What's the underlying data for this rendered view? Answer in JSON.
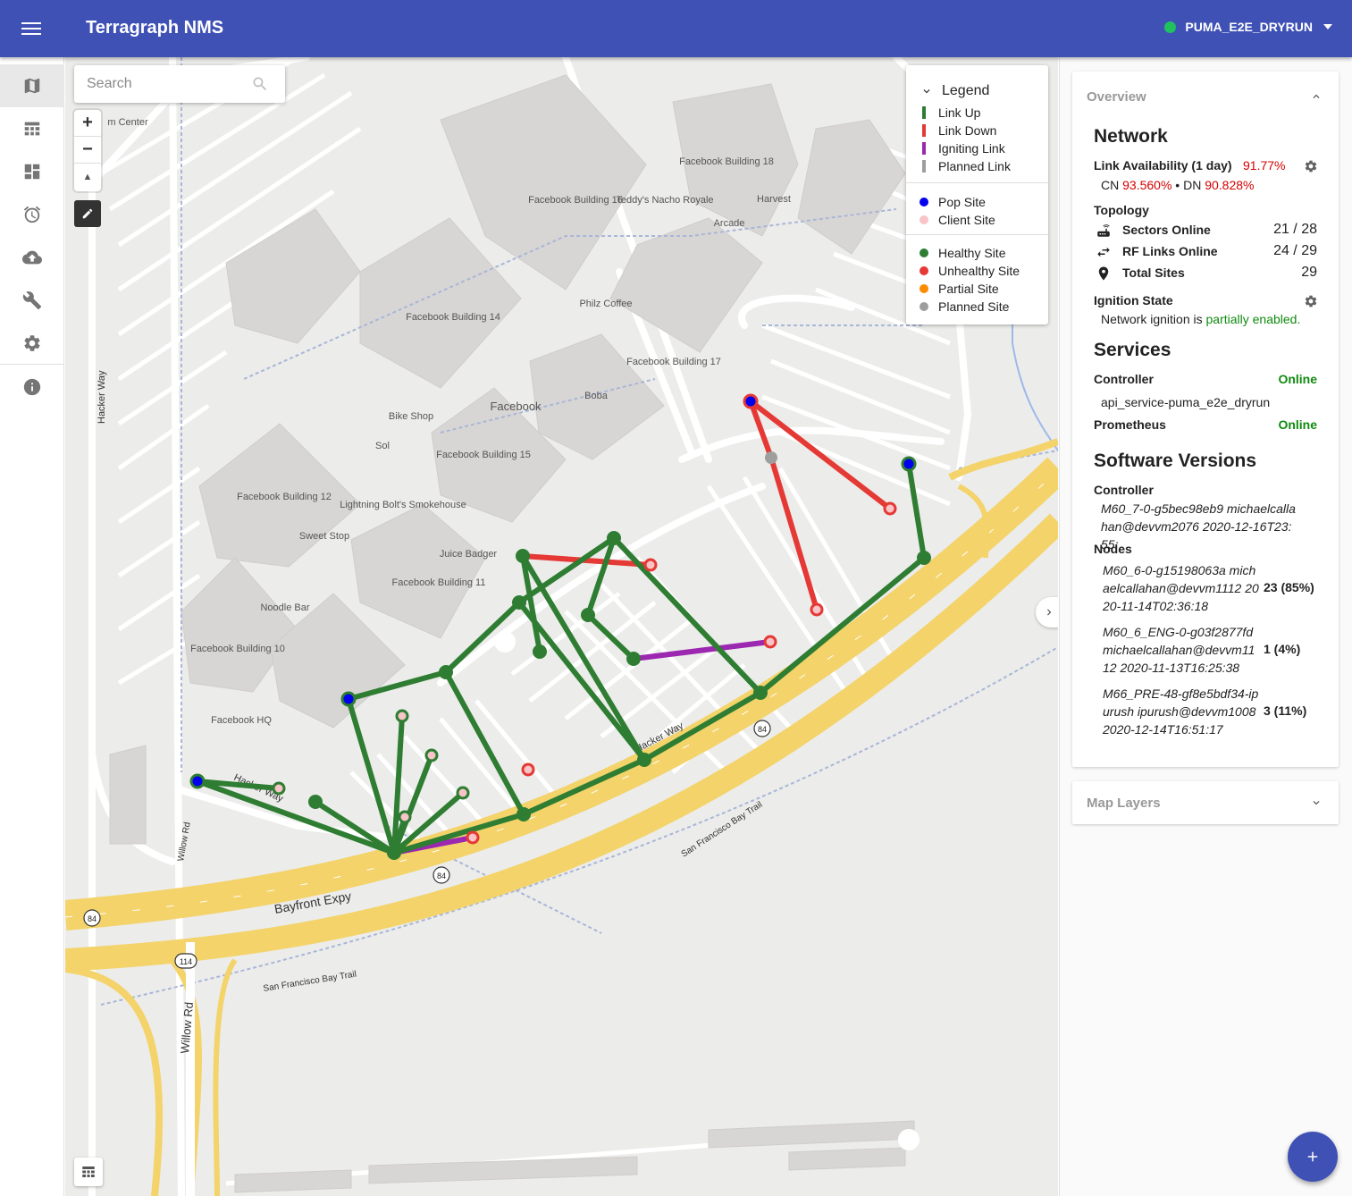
{
  "app": {
    "title": "Terragraph NMS",
    "network_name": "PUMA_E2E_DRYRUN",
    "network_status_color": "#21c25e",
    "brand_color": "#3f51b5"
  },
  "nav": {
    "items": [
      {
        "name": "map-icon",
        "active": true
      },
      {
        "name": "table-icon",
        "active": false
      },
      {
        "name": "dashboard-icon",
        "active": false
      },
      {
        "name": "alarm-icon",
        "active": false
      },
      {
        "name": "cloud-upload-icon",
        "active": false
      },
      {
        "name": "wrench-icon",
        "active": false
      },
      {
        "name": "gear-icon",
        "active": false
      },
      {
        "name": "info-icon",
        "active": false
      }
    ]
  },
  "map": {
    "search_placeholder": "Search",
    "zoom_in": "+",
    "zoom_out": "−",
    "compass": "▲",
    "place_labels": {
      "fb16": "Facebook Building 16",
      "teddys": "Teddy's Nacho Royale",
      "fb18": "Facebook Building 18",
      "harvest": "Harvest",
      "arcade": "Arcade",
      "fb14": "Facebook Building 14",
      "philz": "Philz Coffee",
      "fb17": "Facebook Building 17",
      "boba": "Boba",
      "facebook": "Facebook",
      "bikeshop": "Bike Shop",
      "sol": "Sol",
      "fb15": "Facebook Building 15",
      "fb12": "Facebook Building 12",
      "lightning": "Lightning Bolt's Smokehouse",
      "sweetstop": "Sweet Stop",
      "juicebadger": "Juice Badger",
      "fb11": "Facebook Building 11",
      "noodlebar": "Noodle Bar",
      "fb10": "Facebook Building 10",
      "fbhq": "Facebook HQ",
      "mcenter": "m Center"
    },
    "road_labels": {
      "hacker_way_v": "Hacker Way",
      "hacker_way_1": "Hacker Way",
      "hacker_way_2": "Hacker Way",
      "bayfront": "Bayfront Expy",
      "sfbt_1": "San Francisco Bay Trail",
      "sfbt_2": "San Francisco Bay Trail",
      "willow_1": "Willow Rd",
      "willow_2": "Willow Rd"
    },
    "route_shields": [
      "84",
      "84",
      "84",
      "114"
    ],
    "colors": {
      "link_up": "#2e7d32",
      "link_down": "#e53935",
      "igniting": "#9c27b0",
      "planned": "#9e9e9e",
      "pop": "#0000cc",
      "client": "#f4b6b6"
    }
  },
  "legend": {
    "title": "Legend",
    "links": [
      {
        "label": "Link Up",
        "color": "#2e7d32"
      },
      {
        "label": "Link Down",
        "color": "#e53935"
      },
      {
        "label": "Igniting Link",
        "color": "#9c27b0"
      },
      {
        "label": "Planned Link",
        "color": "#9e9e9e"
      }
    ],
    "site_types": [
      {
        "label": "Pop Site",
        "color": "#0000ee"
      },
      {
        "label": "Client Site",
        "color": "#f8c4c8"
      }
    ],
    "site_health": [
      {
        "label": "Healthy Site",
        "color": "#2e7d32"
      },
      {
        "label": "Unhealthy Site",
        "color": "#e53935"
      },
      {
        "label": "Partial Site",
        "color": "#fb8c00"
      },
      {
        "label": "Planned Site",
        "color": "#9e9e9e"
      }
    ]
  },
  "overview": {
    "header": "Overview",
    "network_title": "Network",
    "availability_label": "Link Availability (1 day)",
    "availability_value": "91.77%",
    "cn_label": "CN",
    "cn_value": "93.560%",
    "dn_sep": "• DN",
    "dn_value": "90.828%",
    "topology_title": "Topology",
    "sectors_label": "Sectors Online",
    "sectors_value": "21 / 28",
    "rf_label": "RF Links Online",
    "rf_value": "24 / 29",
    "sites_label": "Total Sites",
    "sites_value": "29",
    "ignition_title": "Ignition State",
    "ignition_prefix": "Network ignition is",
    "ignition_value": "partially enabled.",
    "services_title": "Services",
    "controller_label": "Controller",
    "controller_status": "Online",
    "controller_id": "api_service-puma_e2e_dryrun",
    "prometheus_label": "Prometheus",
    "prometheus_status": "Online",
    "sw_title": "Software Versions",
    "sw_controller_label": "Controller",
    "sw_controller_version": "M60_7-0-g5bec98eb9 michaelcallahan@devvm2076 2020-12-16T23:55:",
    "sw_nodes_label": "Nodes",
    "nodes": [
      {
        "version": "M60_6-0-g15198063a michaelcallahan@devvm1112 2020-11-14T02:36:18",
        "count": "23 (85%)"
      },
      {
        "version": "M60_6_ENG-0-g03f2877fd michaelcallahan@devvm1112 2020-11-13T16:25:38",
        "count": "1 (4%)"
      },
      {
        "version": "M66_PRE-48-gf8e5bdf34-ipurush ipurush@devvm1008 2020-12-14T16:51:17",
        "count": "3 (11%)"
      }
    ]
  },
  "map_layers": {
    "header": "Map Layers"
  },
  "fab": {
    "label": "+"
  }
}
